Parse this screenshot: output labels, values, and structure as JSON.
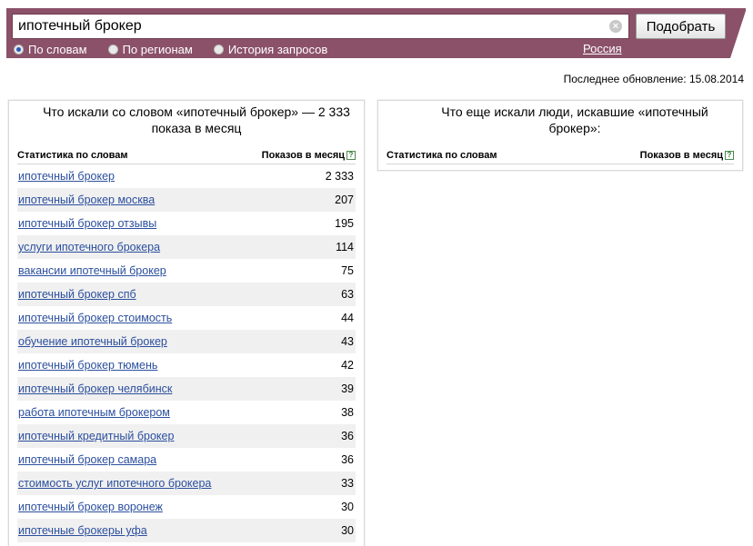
{
  "search": {
    "query": "ипотечный брокер",
    "submit_label": "Подобрать",
    "clear_glyph": "×"
  },
  "modes": [
    {
      "label": "По словам",
      "checked": true
    },
    {
      "label": "По регионам",
      "checked": false
    },
    {
      "label": "История запросов",
      "checked": false
    }
  ],
  "region": "Россия",
  "updated": "Последнее обновление: 15.08.2014",
  "left_panel": {
    "title": "Что искали со словом «ипотечный брокер» — 2 333 показа в месяц",
    "col_words": "Статистика по словам",
    "col_count": "Показов в месяц",
    "help_glyph": "?",
    "rows": [
      {
        "phrase": "ипотечный брокер",
        "count": "2 333"
      },
      {
        "phrase": "ипотечный брокер москва",
        "count": "207"
      },
      {
        "phrase": "ипотечный брокер отзывы",
        "count": "195"
      },
      {
        "phrase": "услуги ипотечного брокера",
        "count": "114"
      },
      {
        "phrase": "вакансии ипотечный брокер",
        "count": "75"
      },
      {
        "phrase": "ипотечный брокер спб",
        "count": "63"
      },
      {
        "phrase": "ипотечный брокер стоимость",
        "count": "44"
      },
      {
        "phrase": "обучение ипотечный брокер",
        "count": "43"
      },
      {
        "phrase": "ипотечный брокер тюмень",
        "count": "42"
      },
      {
        "phrase": "ипотечный брокер челябинск",
        "count": "39"
      },
      {
        "phrase": "работа ипотечным брокером",
        "count": "38"
      },
      {
        "phrase": "ипотечный кредитный брокер",
        "count": "36"
      },
      {
        "phrase": "ипотечный брокер самара",
        "count": "36"
      },
      {
        "phrase": "стоимость услуг ипотечного брокера",
        "count": "33"
      },
      {
        "phrase": "ипотечный брокер воронеж",
        "count": "30"
      },
      {
        "phrase": "ипотечные брокеры уфа",
        "count": "30"
      }
    ]
  },
  "right_panel": {
    "title": "Что еще искали люди, искавшие «ипотечный брокер»:",
    "col_words": "Статистика по словам",
    "col_count": "Показов в месяц",
    "help_glyph": "?"
  },
  "colors": {
    "header_bg": "#8b5168",
    "link": "#2b4f9e",
    "zebra": "#f0f0f0"
  }
}
